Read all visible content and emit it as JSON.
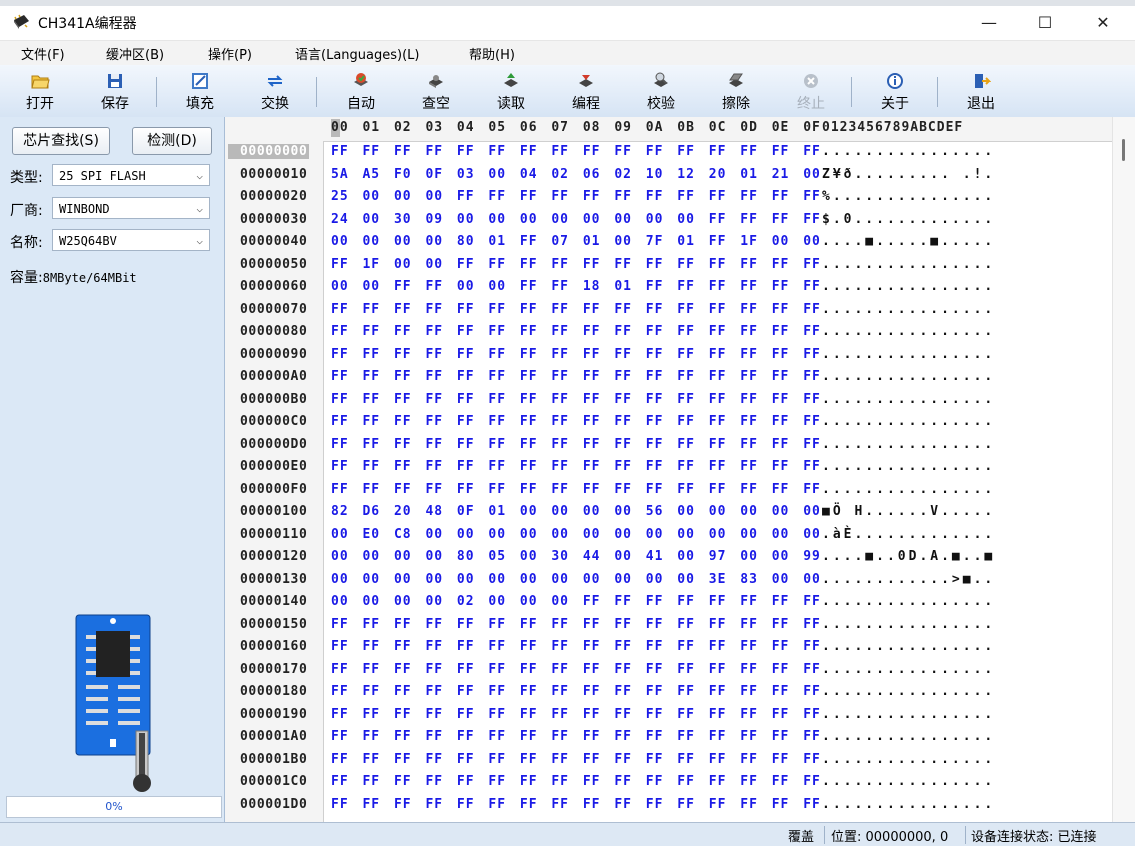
{
  "window": {
    "title": "CH341A编程器",
    "controls": {
      "minimize": "—",
      "maximize": "☐",
      "close": "✕"
    }
  },
  "menu": [
    "文件(F)",
    "缓冲区(B)",
    "操作(P)",
    "语言(Languages)(L)",
    "帮助(H)"
  ],
  "toolbar": [
    {
      "label": "打开",
      "icon": "folder-open-icon",
      "color": "#e8a317",
      "enabled": true
    },
    {
      "label": "保存",
      "icon": "floppy-disk-icon",
      "color": "#2b5fb4",
      "enabled": true
    },
    {
      "label": "填充",
      "icon": "fill-edit-icon",
      "color": "#3f79c7",
      "enabled": true
    },
    {
      "label": "交换",
      "icon": "swap-arrows-icon",
      "color": "#1e64c8",
      "enabled": true
    },
    {
      "label": "自动",
      "icon": "auto-chip-icon",
      "color": "#d94a2b",
      "enabled": true
    },
    {
      "label": "查空",
      "icon": "blank-check-chip-icon",
      "color": "#555555",
      "enabled": true
    },
    {
      "label": "读取",
      "icon": "read-chip-icon",
      "color": "#2e9b3a",
      "enabled": true
    },
    {
      "label": "编程",
      "icon": "program-chip-icon",
      "color": "#d23a2a",
      "enabled": true
    },
    {
      "label": "校验",
      "icon": "verify-chip-icon",
      "color": "#555555",
      "enabled": true
    },
    {
      "label": "擦除",
      "icon": "erase-chip-icon",
      "color": "#555555",
      "enabled": true
    },
    {
      "label": "终止",
      "icon": "stop-icon",
      "color": "#a7b0bb",
      "enabled": false
    },
    {
      "label": "关于",
      "icon": "info-icon",
      "color": "#2b5fb4",
      "enabled": true
    },
    {
      "label": "退出",
      "icon": "exit-door-icon",
      "color": "#2b5fb4",
      "enabled": true
    }
  ],
  "left_panel": {
    "find_chip_button": "芯片查找(S)",
    "detect_button": "检测(D)",
    "type_label": "类型:",
    "type_value": "25 SPI FLASH",
    "vendor_label": "厂商:",
    "vendor_value": "WINBOND",
    "name_label": "名称:",
    "name_value": "W25Q64BV",
    "capacity_label": "容量:",
    "capacity_value": "8MByte/64MBit",
    "progress_text": "0%",
    "progress_fraction": 0
  },
  "hex": {
    "column_header": "00 01 02 03 04 05 06 07 08 09 0A 0B 0C 0D 0E 0F",
    "ascii_header": "0123456789ABCDEF",
    "rows": [
      {
        "addr": "00000000",
        "bytes": "FF FF FF FF FF FF FF FF FF FF FF FF FF FF FF FF",
        "ascii": "................"
      },
      {
        "addr": "00000010",
        "bytes": "5A A5 F0 0F 03 00 04 02 06 02 10 12 20 01 21 00",
        "ascii": "Z¥ð......... .!."
      },
      {
        "addr": "00000020",
        "bytes": "25 00 00 00 FF FF FF FF FF FF FF FF FF FF FF FF",
        "ascii": "%..............."
      },
      {
        "addr": "00000030",
        "bytes": "24 00 30 09 00 00 00 00 00 00 00 00 FF FF FF FF",
        "ascii": "$.0............."
      },
      {
        "addr": "00000040",
        "bytes": "00 00 00 00 80 01 FF 07 01 00 7F 01 FF 1F 00 00",
        "ascii": "....■.....■....."
      },
      {
        "addr": "00000050",
        "bytes": "FF 1F 00 00 FF FF FF FF FF FF FF FF FF FF FF FF",
        "ascii": "................"
      },
      {
        "addr": "00000060",
        "bytes": "00 00 FF FF 00 00 FF FF 18 01 FF FF FF FF FF FF",
        "ascii": "................"
      },
      {
        "addr": "00000070",
        "bytes": "FF FF FF FF FF FF FF FF FF FF FF FF FF FF FF FF",
        "ascii": "................"
      },
      {
        "addr": "00000080",
        "bytes": "FF FF FF FF FF FF FF FF FF FF FF FF FF FF FF FF",
        "ascii": "................"
      },
      {
        "addr": "00000090",
        "bytes": "FF FF FF FF FF FF FF FF FF FF FF FF FF FF FF FF",
        "ascii": "................"
      },
      {
        "addr": "000000A0",
        "bytes": "FF FF FF FF FF FF FF FF FF FF FF FF FF FF FF FF",
        "ascii": "................"
      },
      {
        "addr": "000000B0",
        "bytes": "FF FF FF FF FF FF FF FF FF FF FF FF FF FF FF FF",
        "ascii": "................"
      },
      {
        "addr": "000000C0",
        "bytes": "FF FF FF FF FF FF FF FF FF FF FF FF FF FF FF FF",
        "ascii": "................"
      },
      {
        "addr": "000000D0",
        "bytes": "FF FF FF FF FF FF FF FF FF FF FF FF FF FF FF FF",
        "ascii": "................"
      },
      {
        "addr": "000000E0",
        "bytes": "FF FF FF FF FF FF FF FF FF FF FF FF FF FF FF FF",
        "ascii": "................"
      },
      {
        "addr": "000000F0",
        "bytes": "FF FF FF FF FF FF FF FF FF FF FF FF FF FF FF FF",
        "ascii": "................"
      },
      {
        "addr": "00000100",
        "bytes": "82 D6 20 48 0F 01 00 00 00 00 56 00 00 00 00 00",
        "ascii": "■Ö H......V....."
      },
      {
        "addr": "00000110",
        "bytes": "00 E0 C8 00 00 00 00 00 00 00 00 00 00 00 00 00",
        "ascii": ".àÈ............."
      },
      {
        "addr": "00000120",
        "bytes": "00 00 00 00 80 05 00 30 44 00 41 00 97 00 00 99",
        "ascii": "....■..0D.A.■..■"
      },
      {
        "addr": "00000130",
        "bytes": "00 00 00 00 00 00 00 00 00 00 00 00 3E 83 00 00",
        "ascii": "............>■.."
      },
      {
        "addr": "00000140",
        "bytes": "00 00 00 00 02 00 00 00 FF FF FF FF FF FF FF FF",
        "ascii": "................"
      },
      {
        "addr": "00000150",
        "bytes": "FF FF FF FF FF FF FF FF FF FF FF FF FF FF FF FF",
        "ascii": "................"
      },
      {
        "addr": "00000160",
        "bytes": "FF FF FF FF FF FF FF FF FF FF FF FF FF FF FF FF",
        "ascii": "................"
      },
      {
        "addr": "00000170",
        "bytes": "FF FF FF FF FF FF FF FF FF FF FF FF FF FF FF FF",
        "ascii": "................"
      },
      {
        "addr": "00000180",
        "bytes": "FF FF FF FF FF FF FF FF FF FF FF FF FF FF FF FF",
        "ascii": "................"
      },
      {
        "addr": "00000190",
        "bytes": "FF FF FF FF FF FF FF FF FF FF FF FF FF FF FF FF",
        "ascii": "................"
      },
      {
        "addr": "000001A0",
        "bytes": "FF FF FF FF FF FF FF FF FF FF FF FF FF FF FF FF",
        "ascii": "................"
      },
      {
        "addr": "000001B0",
        "bytes": "FF FF FF FF FF FF FF FF FF FF FF FF FF FF FF FF",
        "ascii": "................"
      },
      {
        "addr": "000001C0",
        "bytes": "FF FF FF FF FF FF FF FF FF FF FF FF FF FF FF FF",
        "ascii": "................"
      },
      {
        "addr": "000001D0",
        "bytes": "FF FF FF FF FF FF FF FF FF FF FF FF FF FF FF FF",
        "ascii": "................"
      }
    ]
  },
  "status": {
    "mode": "覆盖",
    "position": "位置: 00000000, 0",
    "connection": "设备连接状态: 已连接"
  },
  "colors": {
    "hex_bytes": "#1a1ae6",
    "panel_bg": "#dbe8f6",
    "toolbar_bg": "#d6e4f4",
    "selection": "#b9b9b9"
  }
}
